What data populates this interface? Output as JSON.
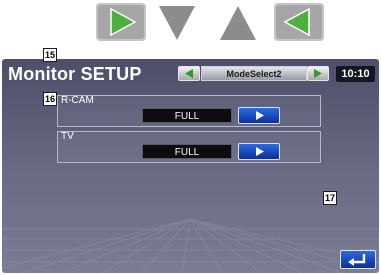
{
  "navigation": {
    "buttons": [
      {
        "icon": "play-right-icon",
        "color": "#4caf3e"
      },
      {
        "icon": "triangle-down-icon",
        "color": "#8c8c8c"
      },
      {
        "icon": "triangle-up-icon",
        "color": "#8c8c8c"
      },
      {
        "icon": "play-left-icon",
        "color": "#4caf3e"
      }
    ]
  },
  "header": {
    "title": "Monitor SETUP",
    "mode_label": "ModeSelect2",
    "clock": "10:10",
    "prev_icon": "triangle-left-icon",
    "next_icon": "triangle-right-icon"
  },
  "settings": [
    {
      "label": "R-CAM",
      "value": "FULL",
      "callout": "15",
      "button_icon": "play-right-icon"
    },
    {
      "label": "TV",
      "value": "FULL",
      "callout": "16",
      "button_icon": "play-right-icon"
    }
  ],
  "footer": {
    "callout": "17",
    "return_icon": "return-arrow-icon"
  },
  "colors": {
    "screen_bg": "#5a5c78",
    "accent_blue": "#1a56d6",
    "nav_green": "#4caf3e",
    "nav_gray": "#8c8c8c"
  }
}
